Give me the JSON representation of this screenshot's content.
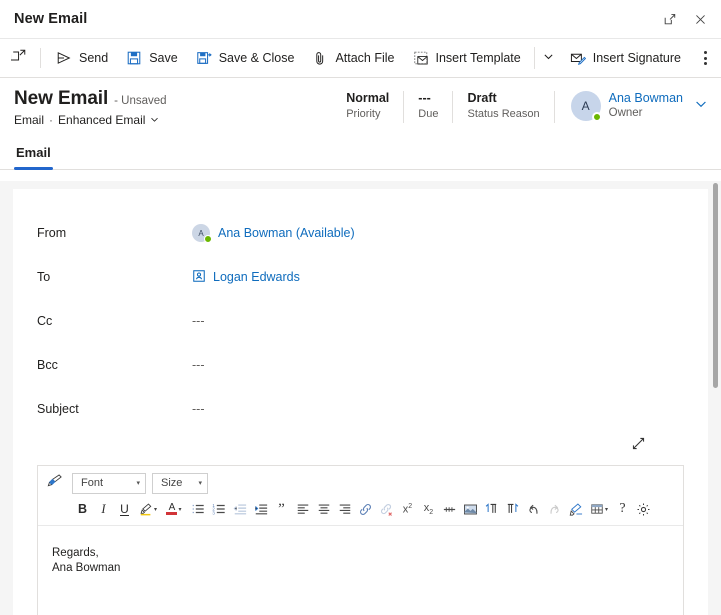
{
  "window": {
    "title": "New Email",
    "popout_icon": "popout-icon",
    "close_icon": "close-icon"
  },
  "commandbar": {
    "new_icon": "new-window-icon",
    "items": [
      {
        "label": "Send",
        "icon": "send-icon"
      },
      {
        "label": "Save",
        "icon": "save-icon"
      },
      {
        "label": "Save & Close",
        "icon": "save-and-close-icon"
      },
      {
        "label": "Attach File",
        "icon": "paperclip-icon"
      },
      {
        "label": "Insert Template",
        "icon": "insert-template-icon"
      },
      {
        "label": "Insert Signature",
        "icon": "insert-signature-icon"
      }
    ],
    "overflow_label": "More commands"
  },
  "record_header": {
    "title": "New Email",
    "unsaved": "- Unsaved",
    "entity": "Email",
    "separator": "·",
    "form_name": "Enhanced Email",
    "stats": [
      {
        "value": "Normal",
        "label": "Priority"
      },
      {
        "value": "---",
        "label": "Due"
      },
      {
        "value": "Draft",
        "label": "Status Reason"
      }
    ],
    "owner": {
      "initial": "A",
      "name": "Ana Bowman",
      "role": "Owner",
      "presence": "available",
      "presence_color": "#6bb700"
    }
  },
  "tabs": [
    {
      "label": "Email",
      "active": true
    }
  ],
  "form": {
    "fields": [
      {
        "label": "From",
        "type": "person",
        "value": "Ana Bowman (Available)",
        "initial": "A",
        "presence": "available"
      },
      {
        "label": "To",
        "type": "contact",
        "value": "Logan Edwards",
        "icon": "contact-card-icon"
      },
      {
        "label": "Cc",
        "type": "empty",
        "value": "---"
      },
      {
        "label": "Bcc",
        "type": "empty",
        "value": "---"
      },
      {
        "label": "Subject",
        "type": "empty",
        "value": "---"
      }
    ]
  },
  "editor": {
    "expand_icon": "expand-diagonal-icon",
    "format_painter_icon": "format-painter-icon",
    "font_select": {
      "value": "Font",
      "caret": "▾"
    },
    "size_select": {
      "value": "Size",
      "caret": "▾"
    },
    "tools": [
      {
        "name": "bold-icon",
        "glyph": "B"
      },
      {
        "name": "italic-icon",
        "glyph": "I"
      },
      {
        "name": "underline-icon",
        "glyph": "U"
      },
      {
        "name": "highlight-color-icon",
        "glyph": ""
      },
      {
        "name": "font-color-icon",
        "glyph": "A"
      },
      {
        "name": "bulleted-list-icon",
        "glyph": ""
      },
      {
        "name": "numbered-list-icon",
        "glyph": ""
      },
      {
        "name": "decrease-indent-icon",
        "glyph": ""
      },
      {
        "name": "increase-indent-icon",
        "glyph": ""
      },
      {
        "name": "blockquote-icon",
        "glyph": "”"
      },
      {
        "name": "align-left-icon",
        "glyph": ""
      },
      {
        "name": "align-center-icon",
        "glyph": ""
      },
      {
        "name": "align-right-icon",
        "glyph": ""
      },
      {
        "name": "insert-link-icon",
        "glyph": ""
      },
      {
        "name": "remove-link-icon",
        "glyph": ""
      },
      {
        "name": "superscript-icon",
        "glyph": "x"
      },
      {
        "name": "subscript-icon",
        "glyph": "x"
      },
      {
        "name": "strikethrough-icon",
        "glyph": ""
      },
      {
        "name": "insert-image-icon",
        "glyph": ""
      },
      {
        "name": "left-to-right-icon",
        "glyph": ""
      },
      {
        "name": "right-to-left-icon",
        "glyph": ""
      },
      {
        "name": "undo-icon",
        "glyph": ""
      },
      {
        "name": "redo-icon",
        "glyph": ""
      },
      {
        "name": "clear-formatting-icon",
        "glyph": ""
      },
      {
        "name": "insert-table-icon",
        "glyph": ""
      },
      {
        "name": "help-icon",
        "glyph": "?"
      },
      {
        "name": "editor-settings-icon",
        "glyph": ""
      }
    ],
    "body_lines": [
      "Regards,",
      "Ana Bowman"
    ]
  },
  "colors": {
    "accent": "#0f6cbd",
    "tab_underline": "#2266cc",
    "presence_green": "#6bb700",
    "body_bg": "#f5f5f5",
    "border": "#e1dfdd",
    "text": "#201f1e",
    "muted": "#605e5c"
  }
}
